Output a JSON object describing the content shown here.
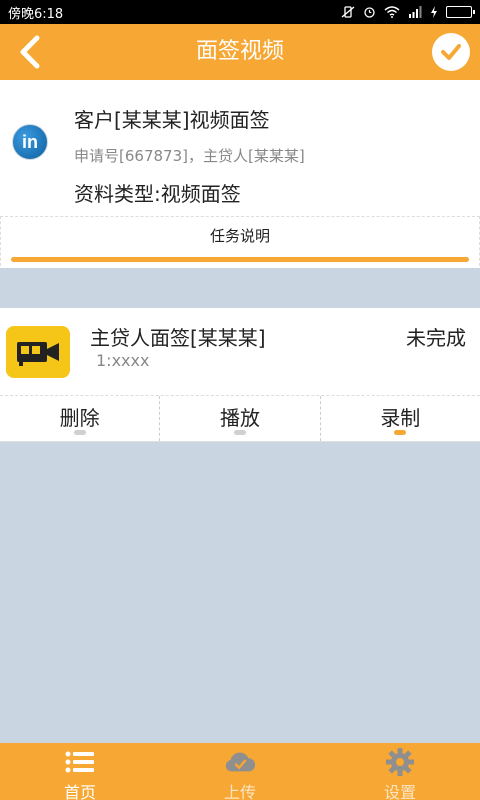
{
  "status_bar": {
    "time": "傍晚6:18"
  },
  "header": {
    "title": "面签视频"
  },
  "info": {
    "logo_text": "in",
    "title": "客户[某某某]视频面签",
    "subtitle": "申请号[667873]，主贷人[某某某]",
    "type": "资料类型:视频面签",
    "task_desc_label": "任务说明"
  },
  "task": {
    "name": "主贷人面签[某某某]",
    "status": "未完成",
    "number": "1:xxxx",
    "actions": [
      {
        "label": "删除",
        "active": false
      },
      {
        "label": "播放",
        "active": false
      },
      {
        "label": "录制",
        "active": true
      }
    ]
  },
  "tabs": [
    {
      "label": "首页",
      "icon": "list-icon",
      "active": true
    },
    {
      "label": "上传",
      "icon": "cloud-upload-icon",
      "active": false
    },
    {
      "label": "设置",
      "icon": "gear-icon",
      "active": false
    }
  ],
  "colors": {
    "accent": "#f7a733",
    "background": "#c9d5e1",
    "camera_bg": "#f5c518"
  }
}
